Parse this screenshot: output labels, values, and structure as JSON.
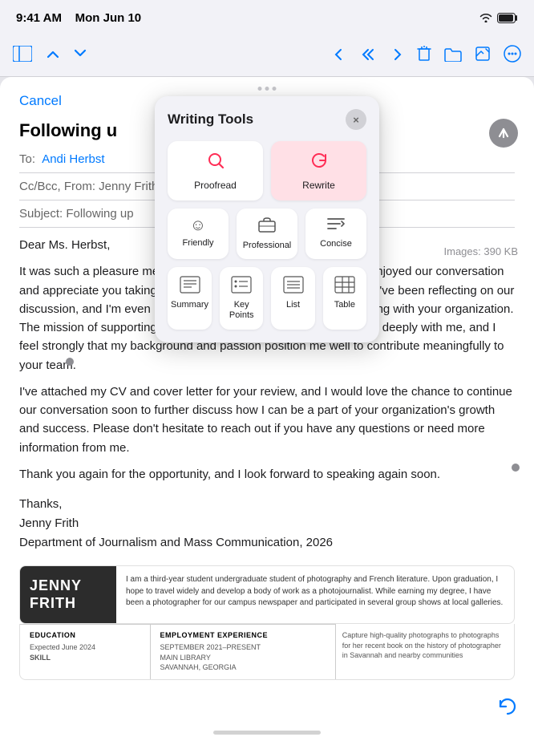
{
  "statusBar": {
    "time": "9:41 AM",
    "date": "Mon Jun 10",
    "wifi": "wifi",
    "battery": "100%"
  },
  "toolbar": {
    "icons": [
      "sidebar",
      "chevron-up",
      "chevron-down",
      "back",
      "back-double",
      "forward",
      "trash",
      "folder",
      "compose",
      "more"
    ]
  },
  "email": {
    "cancel": "Cancel",
    "subject": "Following u",
    "to_label": "To:",
    "to_value": "Andi Herbst",
    "cc_label": "Cc/Bcc, From: Jenny Frith",
    "subject_label": "Subject: Following up",
    "images_info": "Images: 390 KB",
    "greeting": "Dear Ms. Herbst,",
    "body1": "It was such a pleasure meeting you at the conference and I really enjoyed our conversation and appreciate you taking the time to share more about your work. I've been reflecting on our discussion, and I'm even more excited about the possibility of working with your organization. The mission of supporting food security is something that resonates deeply with me, and I feel strongly that my background and passion position me well to contribute meaningfully to your team.",
    "body2": "I've attached my CV and cover letter for your review, and I would love the chance to continue our conversation soon to further discuss how I can be a part of your organization's growth and success. Please don't hesitate to reach out if you have any questions or need more information from me.",
    "body3": "Thank you again for the opportunity, and I look forward to speaking again soon.",
    "closing": "Thanks,",
    "signature1": "Jenny Frith",
    "signature2": "Department of Journalism and Mass Communication, 2026"
  },
  "cv": {
    "firstName": "JENNY",
    "lastName": "FRITH",
    "bio": "I am a third-year student undergraduate student of photography and French literature. Upon graduation, I hope to travel widely and develop a body of work as a photojournalist. While earning my degree, I have been a photographer for our campus newspaper and participated in several group shows at local galleries.",
    "educationTitle": "EDUCATION",
    "educationContent": "Expected June 2024\nSKILL",
    "employmentTitle": "EMPLOYMENT EXPERIENCE",
    "employmentContent": "SEPTEMBER 2021–PRESENT\nMAIN LIBRARY\nSAVANNAH, GEORGIA",
    "employmentDetail": "Capture high-quality photographs to photographs for her recent book on the history of photographer in Savannah and nearby communities"
  },
  "writingTools": {
    "title": "Writing Tools",
    "close_label": "×",
    "buttons": [
      {
        "id": "proofread",
        "label": "Proofread",
        "icon": "🔍",
        "active": false
      },
      {
        "id": "rewrite",
        "label": "Rewrite",
        "icon": "↺",
        "active": true
      }
    ],
    "toneButtons": [
      {
        "id": "friendly",
        "label": "Friendly",
        "icon": "☺"
      },
      {
        "id": "professional",
        "label": "Professional",
        "icon": "🗂"
      },
      {
        "id": "concise",
        "label": "Concise",
        "icon": "≡"
      }
    ],
    "formatButtons": [
      {
        "id": "summary",
        "label": "Summary",
        "icon": "summary"
      },
      {
        "id": "keypoints",
        "label": "Key\nPoints",
        "icon": "keypoints"
      },
      {
        "id": "list",
        "label": "List",
        "icon": "list"
      },
      {
        "id": "table",
        "label": "Table",
        "icon": "table"
      }
    ]
  }
}
